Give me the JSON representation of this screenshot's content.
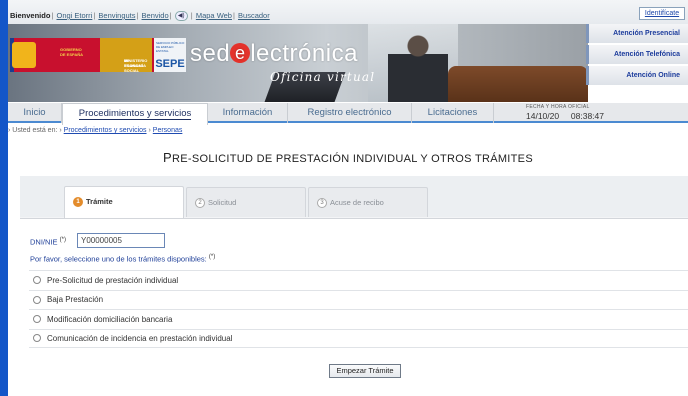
{
  "topbar": {
    "welcome": "Bienvenido",
    "lang_links": [
      "Ongi Etorri",
      "Benvinguts",
      "Benvido"
    ],
    "audio_icon": "speaker-icon",
    "links": [
      "Mapa Web",
      "Buscador"
    ],
    "identificate": "Identifícate"
  },
  "banner": {
    "gov_line1": "GOBIERNO",
    "gov_line2": "DE ESPAÑA",
    "ministry_line1": "MINISTERIO",
    "ministry_line2": "DE TRABAJO",
    "ministry_line3": "Y ECONOMÍA SOCIAL",
    "sepe_small1": "SERVICIO PÚBLICO",
    "sepe_small2": "DE EMPLEO ESTATAL",
    "sepe": "SEPE",
    "logo_pre": "sed",
    "logo_e": "e",
    "logo_post": "lectrónica",
    "subtitle": "Oficina virtual"
  },
  "attention": [
    "Atención Presencial",
    "Atención Telefónica",
    "Atención Online"
  ],
  "nav": {
    "tabs": [
      "Inicio",
      "Procedimientos y servicios",
      "Información",
      "Registro electrónico",
      "Licitaciones"
    ],
    "active": "Procedimientos y servicios"
  },
  "datetime": {
    "label": "FECHA Y HORA OFICIAL",
    "date": "14/10/20",
    "time": "08:38:47"
  },
  "breadcrumb": {
    "prefix": "› Usted está en: ›",
    "link1": "Procedimientos y servicios",
    "sep": "›",
    "link2": "Personas"
  },
  "page": {
    "title_first": "P",
    "title_rest": "RE-SOLICITUD DE PRESTACIÓN INDIVIDUAL Y OTROS TRÁMITES"
  },
  "steps": [
    {
      "num": "1",
      "label": "Trámite"
    },
    {
      "num": "2",
      "label": "Solicitud"
    },
    {
      "num": "3",
      "label": "Acuse de recibo"
    }
  ],
  "form": {
    "dni_label": "DNI/NIE",
    "required_mark": "(*)",
    "dni_value": "Y00000005",
    "instruction": "Por favor, seleccione uno de los trámites disponibles:",
    "options": [
      "Pre-Solicitud de prestación individual",
      "Baja Prestación",
      "Modificación domiciliación bancaria",
      "Comunicación de incidencia en prestación individual"
    ],
    "submit": "Empezar Trámite"
  },
  "colors": {
    "background": "#1356c8",
    "accent": "#4b8ad1",
    "link": "#1f4bb1",
    "step_active": "#e38c2c"
  }
}
